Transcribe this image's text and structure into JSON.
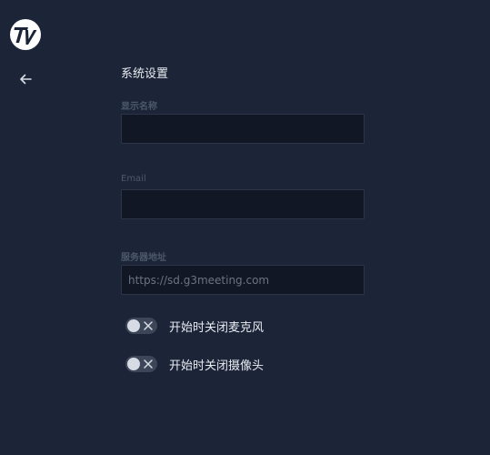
{
  "icons": {
    "logo": "tv-logo-icon",
    "back": "arrow-left-icon",
    "toggle_off": "close-icon"
  },
  "colors": {
    "background": "#1c2538",
    "input_background": "#111724",
    "label": "#4d586b",
    "toggle_track": "#3d4659",
    "toggle_knob": "#d6dbe4"
  },
  "settings": {
    "title": "系统设置",
    "display_name": {
      "label": "显示名称",
      "value": "",
      "placeholder": ""
    },
    "email": {
      "label": "Email",
      "value": "",
      "placeholder": ""
    },
    "server": {
      "label": "服务器地址",
      "value": "",
      "placeholder": "https://sd.g3meeting.com"
    },
    "toggles": [
      {
        "label": "开始时关闭麦克风",
        "enabled": false
      },
      {
        "label": "开始时关闭摄像头",
        "enabled": false
      }
    ]
  }
}
